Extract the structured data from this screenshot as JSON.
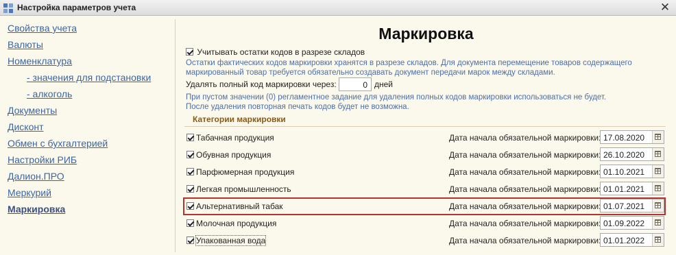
{
  "window": {
    "title": "Настройка параметров учета",
    "close_icon": "close-icon"
  },
  "sidebar": {
    "items": [
      {
        "label": "Свойства учета",
        "active": false
      },
      {
        "label": "Валюты",
        "active": false
      },
      {
        "label": "Номенклатура",
        "active": false
      },
      {
        "label": "- значения для подстановки",
        "active": false
      },
      {
        "label": "- алкоголь",
        "active": false
      },
      {
        "label": "Документы",
        "active": false
      },
      {
        "label": "Дисконт",
        "active": false
      },
      {
        "label": "Обмен с бухгалтерией",
        "active": false
      },
      {
        "label": "Настройки РИБ",
        "active": false
      },
      {
        "label": "Далион.ПРО",
        "active": false
      },
      {
        "label": "Меркурий",
        "active": false
      },
      {
        "label": "Маркировка",
        "active": true
      }
    ]
  },
  "main": {
    "title": "Маркировка",
    "warehouse_checkbox": {
      "label": "Учитывать остатки кодов в разрезе складов",
      "checked": true
    },
    "warehouse_hint_1": "Остатки фактических кодов маркировки хранятся в разрезе складов. Для документа перемещение товаров содержащего",
    "warehouse_hint_2": "маркированный товар требуется обязательно создавать документ передачи марок между складами.",
    "delete_label": "Удалять полный код маркировки через:",
    "delete_value": "0",
    "delete_unit": "дней",
    "delete_hint_1": "При пустом значении (0) регламентное задание для удаления полных кодов маркировки использоваться не будет.",
    "delete_hint_2": "После удаления повторная печать кодов будет не возможна.",
    "categories_title": "Категории маркировки",
    "date_label": "Дата начала обязательной маркировки:",
    "categories": [
      {
        "name": "Табачная продукция",
        "checked": true,
        "date": "17.08.2020",
        "selected": false
      },
      {
        "name": "Обувная продукция",
        "checked": true,
        "date": "26.10.2020",
        "selected": false
      },
      {
        "name": "Парфюмерная продукция",
        "checked": true,
        "date": "01.10.2021",
        "selected": false
      },
      {
        "name": "Легкая промышленность",
        "checked": true,
        "date": "01.01.2021",
        "selected": false
      },
      {
        "name": "Альтернативный табак",
        "checked": true,
        "date": "01.07.2021",
        "selected": true
      },
      {
        "name": "Молочная продукция",
        "checked": true,
        "date": "01.09.2022",
        "selected": false
      },
      {
        "name": "Упакованная вода",
        "checked": true,
        "date": "01.01.2022",
        "selected": false
      }
    ]
  },
  "colors": {
    "background": "#fbf9ec",
    "link": "#3a65a5",
    "hint": "#4d6ea8",
    "section_title": "#8a5a16",
    "selection": "#b8312f"
  }
}
